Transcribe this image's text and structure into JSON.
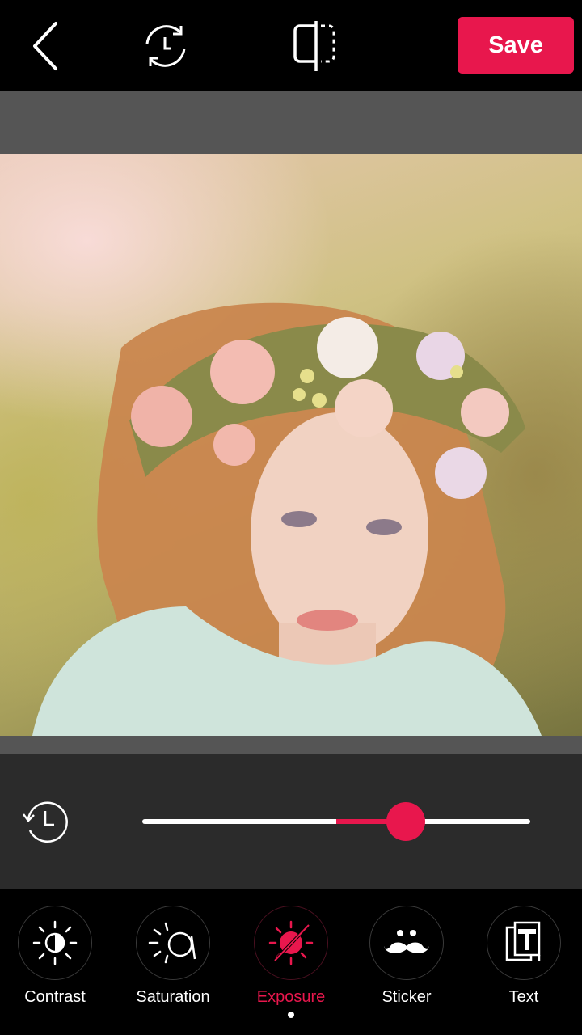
{
  "topbar": {
    "save_label": "Save",
    "accent_color": "#e8174d"
  },
  "icons": {
    "back": "back-arrow-icon",
    "history": "history-icon",
    "compare": "compare-split-icon",
    "reset": "reset-history-icon"
  },
  "adjustment": {
    "name": "Exposure",
    "value_fraction": 0.68,
    "neutral_fraction": 0.5
  },
  "tools": [
    {
      "label": "Contrast",
      "icon": "contrast-icon",
      "active": false
    },
    {
      "label": "Saturation",
      "icon": "saturation-icon",
      "active": false
    },
    {
      "label": "Exposure",
      "icon": "exposure-icon",
      "active": true
    },
    {
      "label": "Sticker",
      "icon": "mustache-sticker-icon",
      "active": false
    },
    {
      "label": "Text",
      "icon": "text-icon",
      "active": false
    }
  ]
}
